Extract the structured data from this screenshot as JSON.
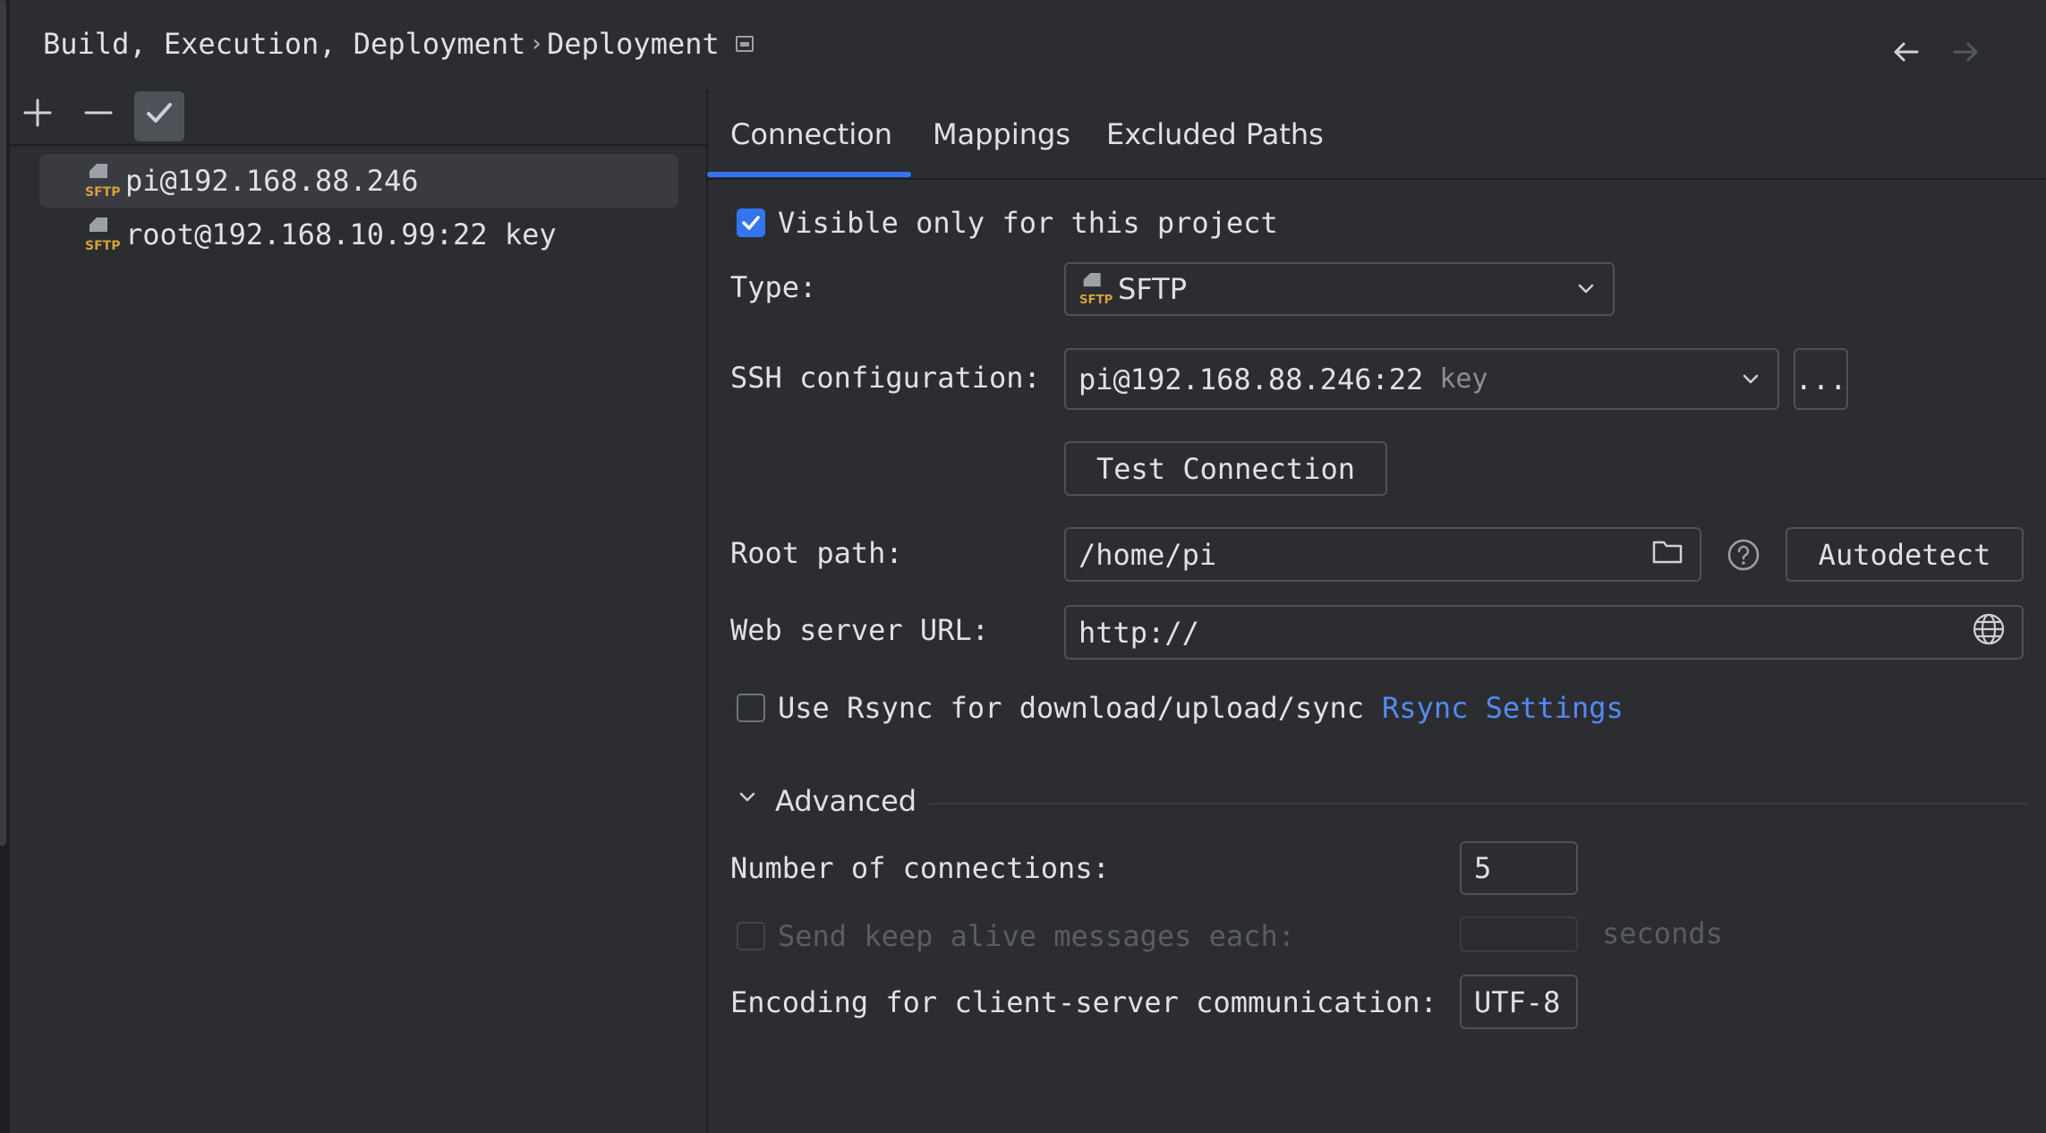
{
  "header": {
    "breadcrumb_parent": "Build, Execution, Deployment",
    "breadcrumb_sep": "›",
    "breadcrumb_current": "Deployment"
  },
  "toolbar": {
    "add_icon": "plus-icon",
    "remove_icon": "minus-icon",
    "default_icon": "check-icon"
  },
  "servers": [
    {
      "label": "pi@192.168.88.246",
      "icon": "sftp-icon",
      "selected": true
    },
    {
      "label": "root@192.168.10.99:22 key",
      "icon": "sftp-icon",
      "selected": false
    }
  ],
  "tabs": [
    {
      "label": "Connection",
      "active": true
    },
    {
      "label": "Mappings",
      "active": false
    },
    {
      "label": "Excluded Paths",
      "active": false
    }
  ],
  "form": {
    "visible_only_label": "Visible only for this project",
    "visible_only_checked": true,
    "type_label": "Type:",
    "type_value": "SFTP",
    "ssh_label": "SSH configuration:",
    "ssh_value": "pi@192.168.88.246:22",
    "ssh_hint": "key",
    "ssh_more_label": "...",
    "test_connection_label": "Test Connection",
    "root_path_label": "Root path:",
    "root_path_value": "/home/pi",
    "autodetect_label": "Autodetect",
    "web_url_label": "Web server URL:",
    "web_url_value": "http://",
    "rsync_label": "Use Rsync for download/upload/sync",
    "rsync_checked": false,
    "rsync_settings_link": "Rsync Settings",
    "advanced_label": "Advanced",
    "connections_label": "Number of connections:",
    "connections_value": "5",
    "keepalive_label": "Send keep alive messages each:",
    "keepalive_value": "",
    "keepalive_unit": "seconds",
    "encoding_label": "Encoding for client-server communication:",
    "encoding_value": "UTF-8"
  },
  "colors": {
    "background": "#2b2d30",
    "accent": "#3574f0",
    "link": "#548af7",
    "sftp_icon": "#d4a13b"
  }
}
